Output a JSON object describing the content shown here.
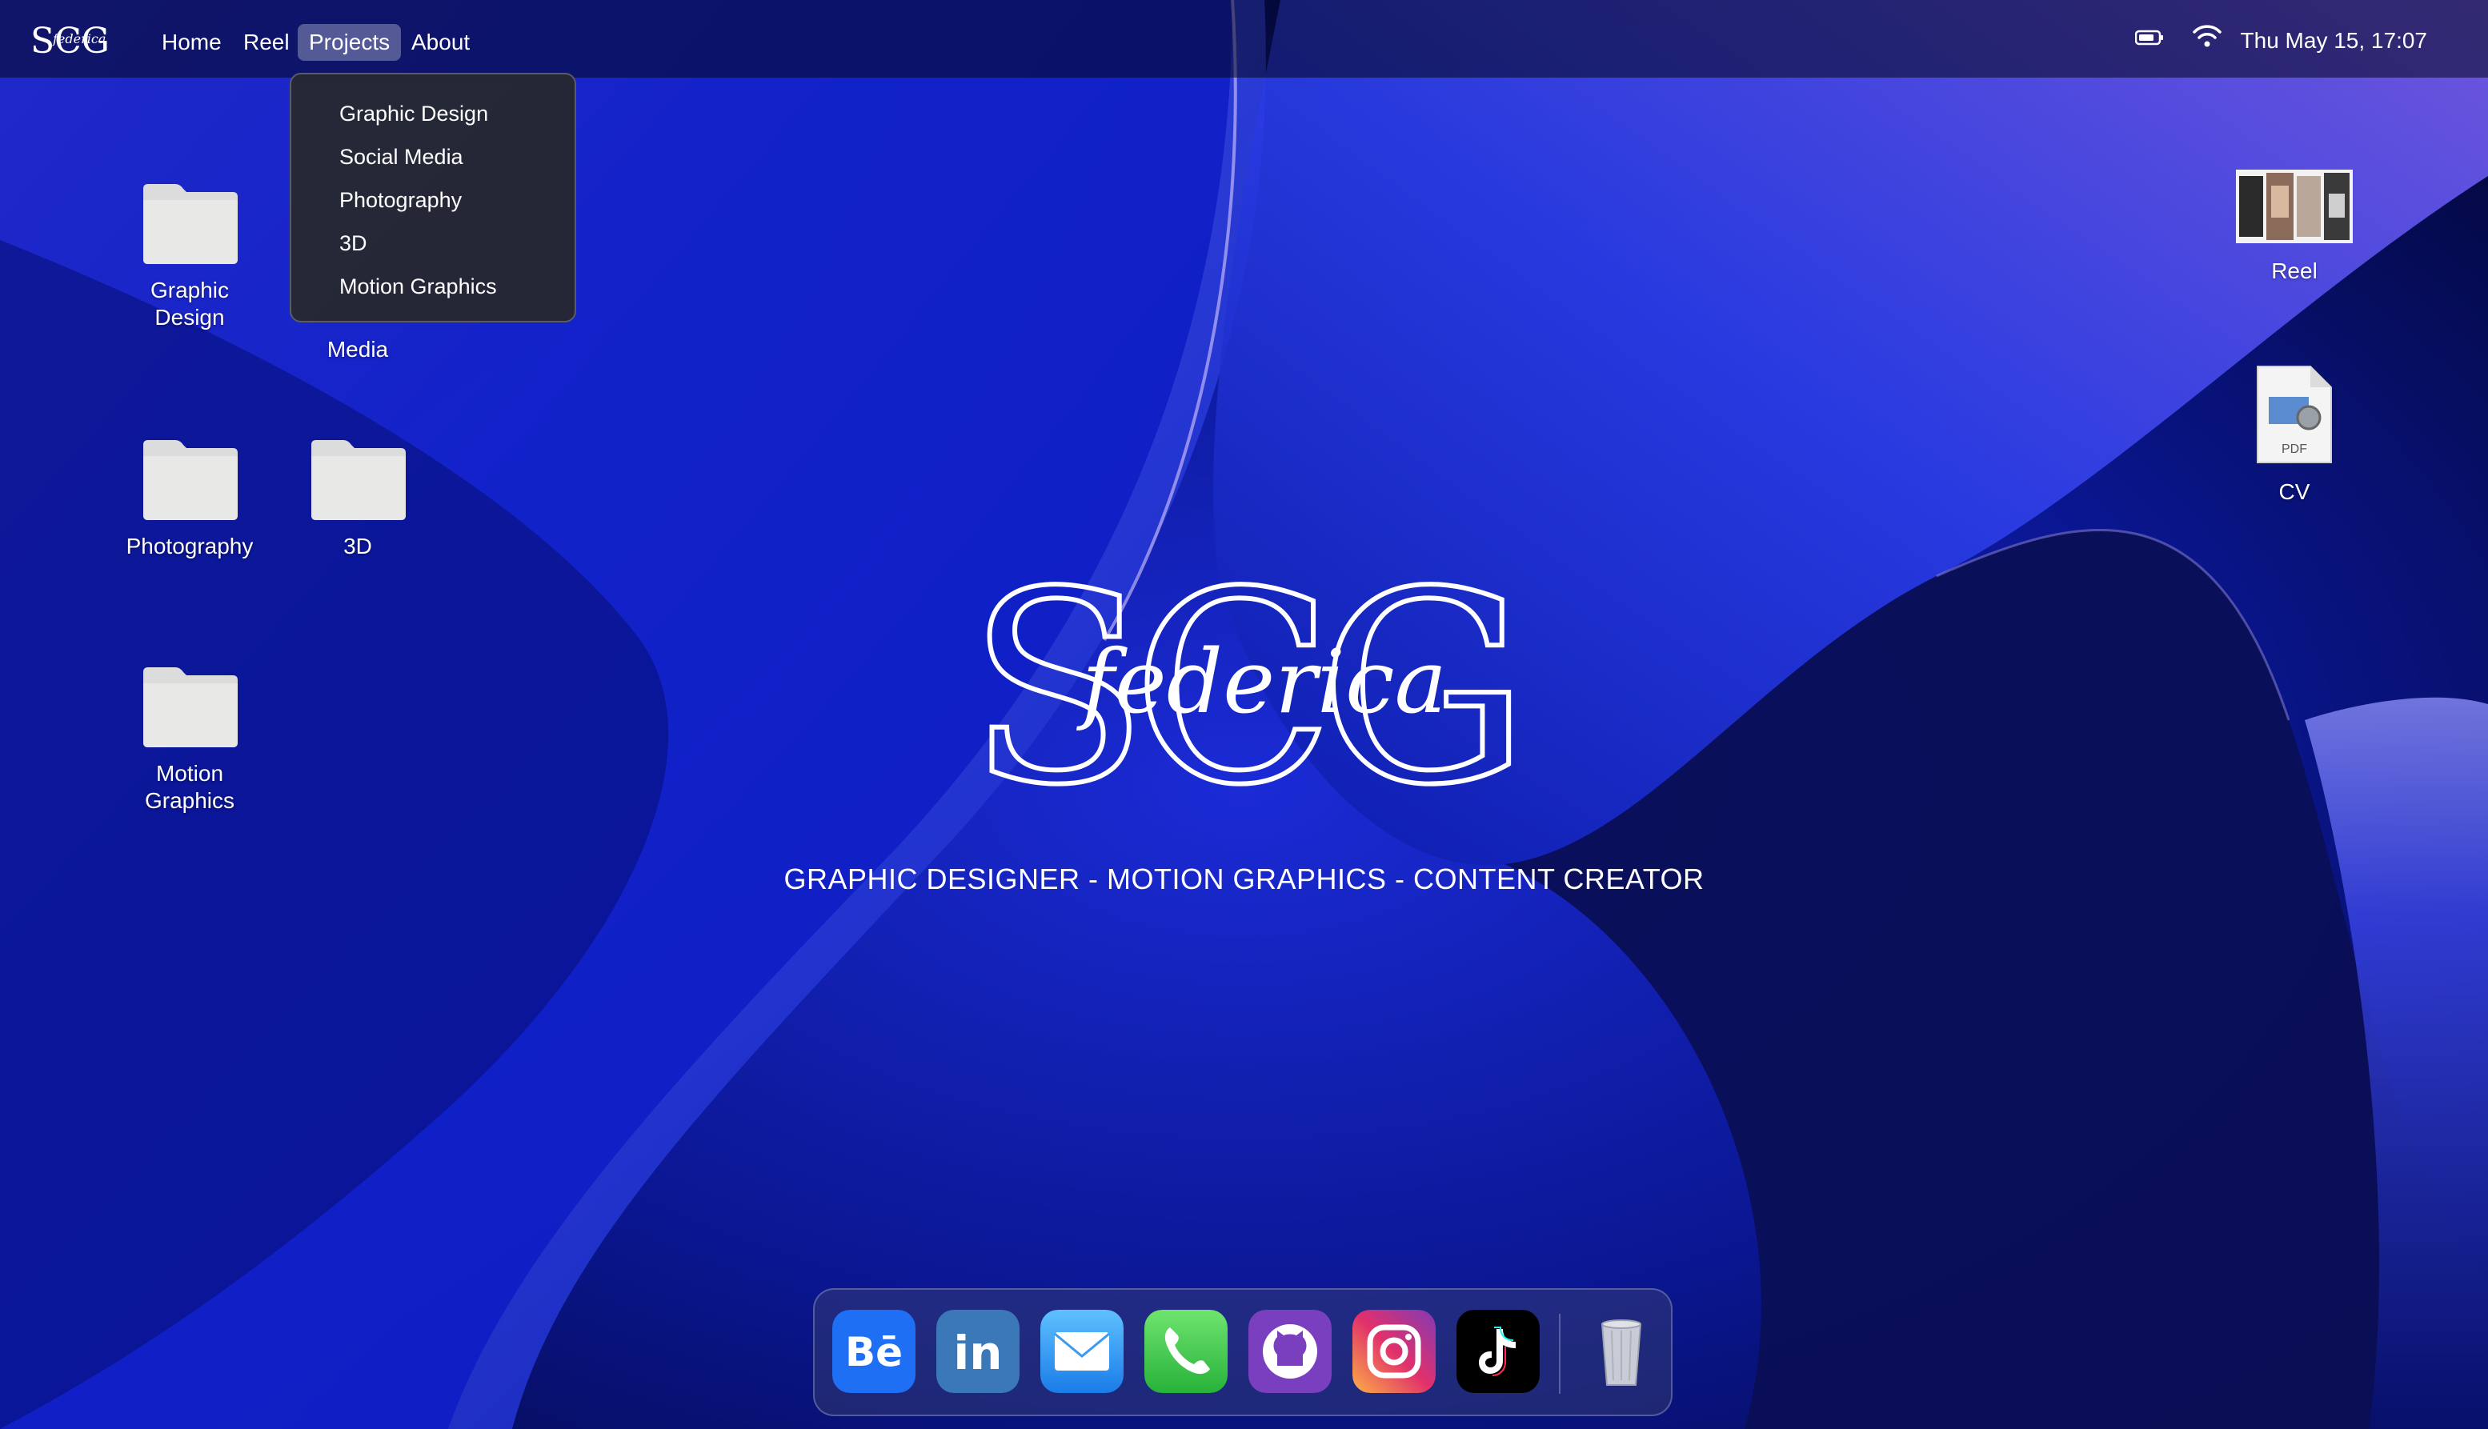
{
  "menubar": {
    "logo": "SCG federica",
    "items": [
      {
        "label": "Home"
      },
      {
        "label": "Reel"
      },
      {
        "label": "Projects"
      },
      {
        "label": "About"
      }
    ],
    "clock": "Thu May 15, 17:07"
  },
  "projects_menu": {
    "items": [
      {
        "label": "Graphic Design"
      },
      {
        "label": "Social Media"
      },
      {
        "label": "Photography"
      },
      {
        "label": "3D"
      },
      {
        "label": "Motion Graphics"
      }
    ]
  },
  "desktop": {
    "folders": [
      {
        "label": "Graphic Design"
      },
      {
        "label": "Media"
      },
      {
        "label": "Photography"
      },
      {
        "label": "3D"
      },
      {
        "label": "Motion Graphics"
      }
    ],
    "files": [
      {
        "label": "Reel"
      },
      {
        "label": "CV",
        "badge": "PDF"
      }
    ]
  },
  "brand": {
    "letters": "SCG",
    "script": "federica",
    "tagline": "GRAPHIC DESIGNER - MOTION GRAPHICS - CONTENT CREATOR"
  },
  "dock": {
    "apps": [
      {
        "name": "behance-icon",
        "glyph": "Bē",
        "color": "#1f6ff5"
      },
      {
        "name": "linkedin-icon",
        "glyph": "in",
        "color": "#3a78b8"
      },
      {
        "name": "mail-icon",
        "color": "#3b9bf0"
      },
      {
        "name": "phone-icon",
        "color": "#3bc64b"
      },
      {
        "name": "github-icon",
        "color": "#7a3fbf"
      },
      {
        "name": "instagram-icon",
        "color": "#e1306c"
      },
      {
        "name": "tiktok-icon",
        "color": "#000000"
      },
      {
        "name": "trash-icon",
        "color": "#c9ccd6"
      }
    ]
  }
}
